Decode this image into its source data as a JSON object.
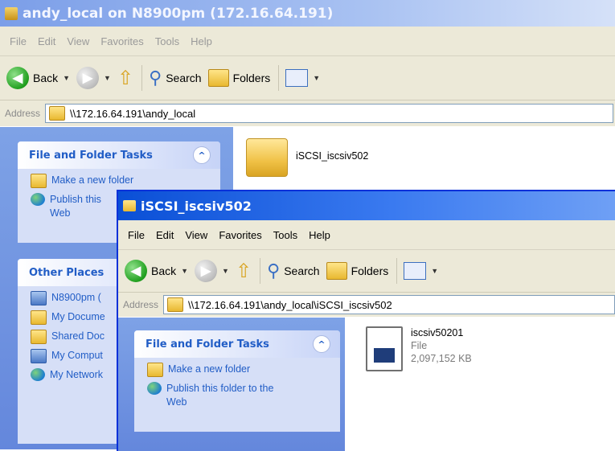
{
  "window_back": {
    "title": "andy_local on N8900pm (172.16.64.191)",
    "menu": [
      "File",
      "Edit",
      "View",
      "Favorites",
      "Tools",
      "Help"
    ],
    "toolbar": {
      "back": "Back",
      "search": "Search",
      "folders": "Folders"
    },
    "address_label": "Address",
    "address_value": "\\\\172.16.64.191\\andy_local",
    "file_tasks": {
      "title": "File and Folder Tasks",
      "items": [
        "Make a new folder",
        "Publish this",
        "Web"
      ]
    },
    "other_places": {
      "title": "Other Places",
      "items": [
        "N8900pm (",
        "My Docume",
        "Shared Doc",
        "My Comput",
        "My Network"
      ]
    },
    "content_item": "iSCSI_iscsiv502"
  },
  "window_front": {
    "title": "iSCSI_iscsiv502",
    "menu": [
      "File",
      "Edit",
      "View",
      "Favorites",
      "Tools",
      "Help"
    ],
    "toolbar": {
      "back": "Back",
      "search": "Search",
      "folders": "Folders"
    },
    "address_label": "Address",
    "address_value": "\\\\172.16.64.191\\andy_local\\iSCSI_iscsiv502",
    "file_tasks": {
      "title": "File and Folder Tasks",
      "items": [
        "Make a new folder",
        "Publish this folder to the",
        "Web"
      ]
    },
    "file": {
      "name": "iscsiv50201",
      "type": "File",
      "size": "2,097,152 KB"
    }
  },
  "icons": [
    "back-icon",
    "forward-icon",
    "up-folder-icon",
    "search-icon",
    "folders-icon",
    "views-icon",
    "folder-icon",
    "globe-icon",
    "computer-icon",
    "file-icon"
  ]
}
